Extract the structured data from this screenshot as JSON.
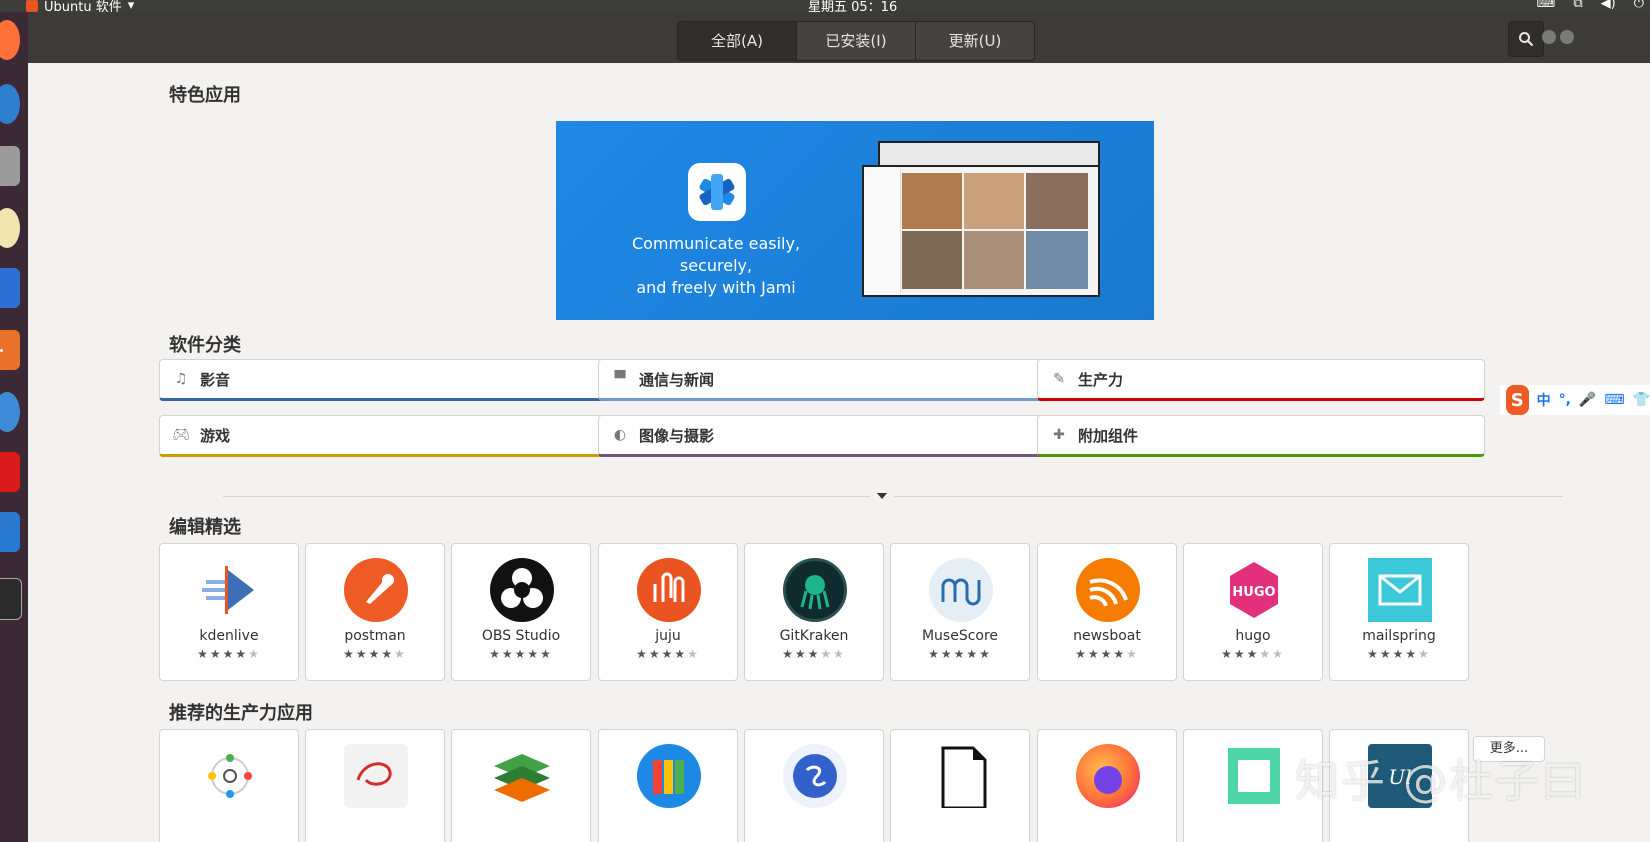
{
  "top_panel": {
    "app_name": "Ubuntu 软件",
    "clock": "星期五 05：16"
  },
  "header": {
    "tabs": [
      "全部(A)",
      "已安装(I)",
      "更新(U)"
    ]
  },
  "sections": {
    "featured": "特色应用",
    "categories": "软件分类",
    "editors_picks": "编辑精选",
    "recommended_productivity": "推荐的生产力应用"
  },
  "banner": {
    "text_line1": "Communicate easily, securely,",
    "text_line2": "and freely with Jami"
  },
  "categories": [
    {
      "label": "影音",
      "icon": "music-note-icon",
      "color": "#3465a4"
    },
    {
      "label": "通信与新闻",
      "icon": "chat-bubble-icon",
      "color": "#729fcf"
    },
    {
      "label": "生产力",
      "icon": "pencil-edit-icon",
      "color": "#cc0000"
    },
    {
      "label": "游戏",
      "icon": "gamepad-icon",
      "color": "#c4a000"
    },
    {
      "label": "图像与摄影",
      "icon": "palette-icon",
      "color": "#75507b"
    },
    {
      "label": "附加组件",
      "icon": "puzzle-piece-icon",
      "color": "#4e9a06"
    }
  ],
  "editors_picks": [
    {
      "name": "kdenlive",
      "rating": 4,
      "color": "#3d6fb6"
    },
    {
      "name": "postman",
      "rating": 4,
      "color": "#ef5b25"
    },
    {
      "name": "OBS Studio",
      "rating": 5,
      "color": "#111111"
    },
    {
      "name": "juju",
      "rating": 4,
      "color": "#e95420"
    },
    {
      "name": "GitKraken",
      "rating": 3,
      "color": "#0f2b2d"
    },
    {
      "name": "MuseScore",
      "rating": 5,
      "color": "#e6eef5"
    },
    {
      "name": "newsboat",
      "rating": 4,
      "color": "#f57c00"
    },
    {
      "name": "hugo",
      "rating": 3,
      "color": "#e2317a"
    },
    {
      "name": "mailspring",
      "rating": 4,
      "color": "#3bc8d8"
    }
  ],
  "recommended": [
    {
      "icon": "dots-circle-icon",
      "color": "#ffffff"
    },
    {
      "icon": "red-swirl-icon",
      "color": "#d32f2f"
    },
    {
      "icon": "layers-stack-icon",
      "color": "#2e7d32"
    },
    {
      "icon": "binders-icon",
      "color": "#1e88e5"
    },
    {
      "icon": "simplenote-icon",
      "color": "#3361cc"
    },
    {
      "icon": "document-icon",
      "color": "#ffffff"
    },
    {
      "icon": "firefox-icon",
      "color": "#ff7139"
    },
    {
      "icon": "green-square-icon",
      "color": "#4cd6a9"
    },
    {
      "icon": "ul-icon",
      "color": "#1f5b78"
    }
  ],
  "more_button": "更多...",
  "ime": {
    "items": [
      "中",
      "°,",
      "🎤",
      "⌨",
      "👕"
    ]
  },
  "watermark": "知乎 @杜子曰"
}
